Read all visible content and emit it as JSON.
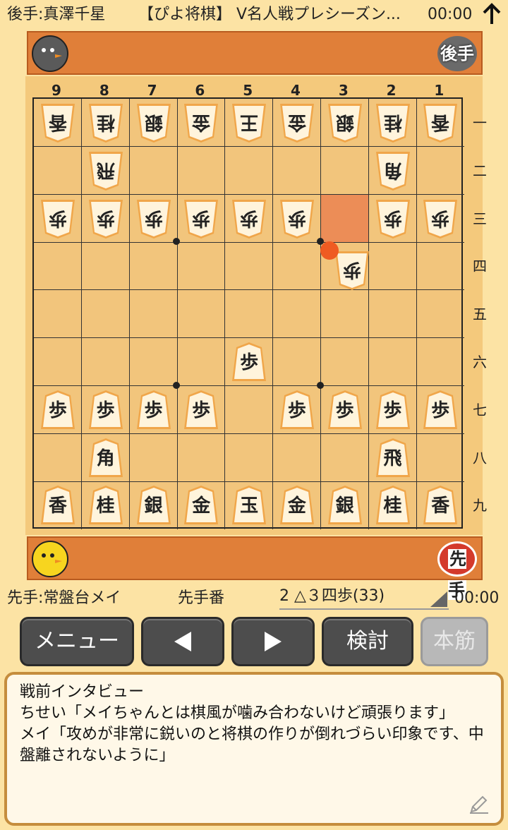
{
  "header": {
    "gote_player": "後手:真澤千星",
    "title": "【ぴよ将棋】 V名人戦プレシーズン...",
    "time": "00:00"
  },
  "stands": {
    "gote_badge": "後手",
    "sente_badge": "先手"
  },
  "board": {
    "col_labels": [
      "9",
      "8",
      "7",
      "6",
      "5",
      "4",
      "3",
      "2",
      "1"
    ],
    "row_labels": [
      "一",
      "二",
      "三",
      "四",
      "五",
      "六",
      "七",
      "八",
      "九"
    ],
    "highlight_square": "3三",
    "pieces": [
      {
        "owner": "gote",
        "char": "香",
        "file": 9,
        "rank": 1
      },
      {
        "owner": "gote",
        "char": "桂",
        "file": 8,
        "rank": 1
      },
      {
        "owner": "gote",
        "char": "銀",
        "file": 7,
        "rank": 1
      },
      {
        "owner": "gote",
        "char": "金",
        "file": 6,
        "rank": 1
      },
      {
        "owner": "gote",
        "char": "王",
        "file": 5,
        "rank": 1
      },
      {
        "owner": "gote",
        "char": "金",
        "file": 4,
        "rank": 1
      },
      {
        "owner": "gote",
        "char": "銀",
        "file": 3,
        "rank": 1
      },
      {
        "owner": "gote",
        "char": "桂",
        "file": 2,
        "rank": 1
      },
      {
        "owner": "gote",
        "char": "香",
        "file": 1,
        "rank": 1
      },
      {
        "owner": "gote",
        "char": "飛",
        "file": 8,
        "rank": 2
      },
      {
        "owner": "gote",
        "char": "角",
        "file": 2,
        "rank": 2
      },
      {
        "owner": "gote",
        "char": "歩",
        "file": 9,
        "rank": 3
      },
      {
        "owner": "gote",
        "char": "歩",
        "file": 8,
        "rank": 3
      },
      {
        "owner": "gote",
        "char": "歩",
        "file": 7,
        "rank": 3
      },
      {
        "owner": "gote",
        "char": "歩",
        "file": 6,
        "rank": 3
      },
      {
        "owner": "gote",
        "char": "歩",
        "file": 5,
        "rank": 3
      },
      {
        "owner": "gote",
        "char": "歩",
        "file": 4,
        "rank": 3
      },
      {
        "owner": "gote",
        "char": "歩",
        "file": 2,
        "rank": 3
      },
      {
        "owner": "gote",
        "char": "歩",
        "file": 1,
        "rank": 3
      },
      {
        "owner": "gote",
        "char": "歩",
        "file": 3,
        "rank": 4
      },
      {
        "owner": "sente",
        "char": "歩",
        "file": 5,
        "rank": 6
      },
      {
        "owner": "sente",
        "char": "歩",
        "file": 9,
        "rank": 7
      },
      {
        "owner": "sente",
        "char": "歩",
        "file": 8,
        "rank": 7
      },
      {
        "owner": "sente",
        "char": "歩",
        "file": 7,
        "rank": 7
      },
      {
        "owner": "sente",
        "char": "歩",
        "file": 6,
        "rank": 7
      },
      {
        "owner": "sente",
        "char": "歩",
        "file": 4,
        "rank": 7
      },
      {
        "owner": "sente",
        "char": "歩",
        "file": 3,
        "rank": 7
      },
      {
        "owner": "sente",
        "char": "歩",
        "file": 2,
        "rank": 7
      },
      {
        "owner": "sente",
        "char": "歩",
        "file": 1,
        "rank": 7
      },
      {
        "owner": "sente",
        "char": "角",
        "file": 8,
        "rank": 8
      },
      {
        "owner": "sente",
        "char": "飛",
        "file": 2,
        "rank": 8
      },
      {
        "owner": "sente",
        "char": "香",
        "file": 9,
        "rank": 9
      },
      {
        "owner": "sente",
        "char": "桂",
        "file": 8,
        "rank": 9
      },
      {
        "owner": "sente",
        "char": "銀",
        "file": 7,
        "rank": 9
      },
      {
        "owner": "sente",
        "char": "金",
        "file": 6,
        "rank": 9
      },
      {
        "owner": "sente",
        "char": "玉",
        "file": 5,
        "rank": 9
      },
      {
        "owner": "sente",
        "char": "金",
        "file": 4,
        "rank": 9
      },
      {
        "owner": "sente",
        "char": "銀",
        "file": 3,
        "rank": 9
      },
      {
        "owner": "sente",
        "char": "桂",
        "file": 2,
        "rank": 9
      },
      {
        "owner": "sente",
        "char": "香",
        "file": 1,
        "rank": 9
      }
    ]
  },
  "status": {
    "sente_player": "先手:常盤台メイ",
    "turn": "先手番",
    "move": "2 △３四歩(33)",
    "time": "00:00"
  },
  "buttons": {
    "menu": "メニュー",
    "review": "検討",
    "mainline": "本筋"
  },
  "comment": {
    "lines": [
      "戦前インタビュー",
      "ちせい「メイちゃんとは棋風が噛み合わないけど頑張ります」",
      "メイ「攻めが非常に鋭いのと将棋の作りが倒れづらい印象です、中盤離されないように」"
    ]
  },
  "colors": {
    "background": "#fce3a4",
    "stand": "#e07f39",
    "board": "#f2c57c",
    "highlight": "#ec8d57",
    "button": "#4d4d4d"
  }
}
